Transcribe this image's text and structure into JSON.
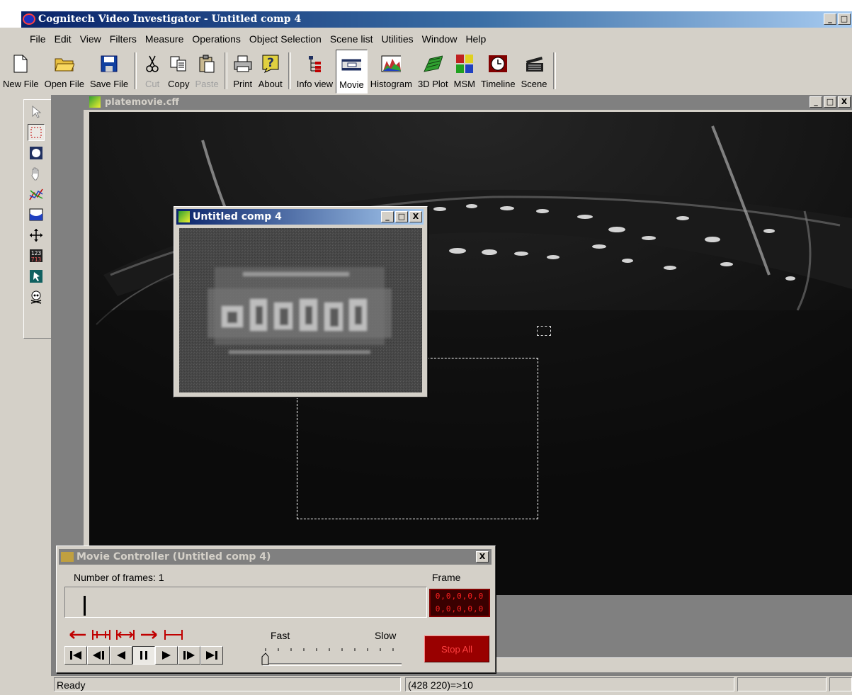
{
  "app": {
    "title": "Cognitech Video Investigator - Untitled comp 4",
    "win_min": "_",
    "win_max": "□"
  },
  "menu": [
    "File",
    "Edit",
    "View",
    "Filters",
    "Measure",
    "Operations",
    "Object Selection",
    "Scene list",
    "Utilities",
    "Window",
    "Help"
  ],
  "toolbar": {
    "new_file": "New File",
    "open_file": "Open File",
    "save_file": "Save File",
    "cut": "Cut",
    "copy": "Copy",
    "paste": "Paste",
    "print": "Print",
    "about": "About",
    "info_view": "Info view",
    "movie": "Movie",
    "histogram": "Histogram",
    "plot_3d": "3D Plot",
    "msm": "MSM",
    "timeline": "Timeline",
    "scene": "Scene"
  },
  "document": {
    "title": "platemovie.cff",
    "btn_min": "_",
    "btn_max": "□",
    "btn_close": "X"
  },
  "child_window": {
    "title": "Untitled comp 4",
    "btn_min": "_",
    "btn_max": "□",
    "btn_close": "X"
  },
  "movie_controller": {
    "title": "Movie Controller (Untitled comp 4)",
    "close": "X",
    "frames_label": "Number of frames:  1",
    "frame_label": "Frame",
    "frame_lcd_top": "0,0,0,0,0",
    "frame_lcd_bottom": "0,0,0,0,0",
    "fast_label": "Fast",
    "slow_label": "Slow",
    "stop_all": "Stop All",
    "speed_level": 0
  },
  "status": {
    "ready": "Ready",
    "coords": "(428 220)=>10"
  },
  "colors": {
    "active_title": "#0a246a",
    "inactive_title": "#808080",
    "face": "#d4d0c8",
    "stop_button": "#990000"
  }
}
